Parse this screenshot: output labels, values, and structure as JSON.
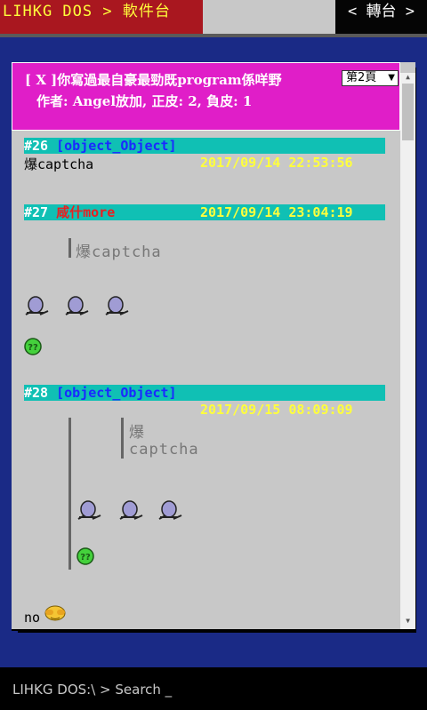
{
  "nav": {
    "breadcrumb": "LIHKG DOS > 軟件台",
    "repost": "< 轉台 >"
  },
  "thread": {
    "title": "[ X ]你寫過最自豪最勁既program係咩野",
    "meta": "作者: Angel放加, 正皮: 2, 負皮: 1",
    "page_select": "第2頁"
  },
  "posts": [
    {
      "num": "#26",
      "user": "[object_Object]",
      "timestamp": "2017/09/14 22:53:56",
      "content": "爆captcha"
    },
    {
      "num": "#27",
      "user": "咸什more",
      "timestamp": "2017/09/14 23:04:19",
      "quote": "爆captcha"
    },
    {
      "num": "#28",
      "user": "[object_Object]",
      "timestamp": "2017/09/15 08:09:09",
      "quote_line1": "爆",
      "quote_line2": "captcha",
      "reply": "no"
    }
  ],
  "prompt": {
    "text": "LIHKG DOS:\\ > Search _"
  },
  "colors": {
    "background": "#1a2a86",
    "header": "#e01ec8",
    "post_bar": "#10c0b4",
    "timestamp": "#ffff3c",
    "breadcrumb_bg": "#a9171f"
  }
}
